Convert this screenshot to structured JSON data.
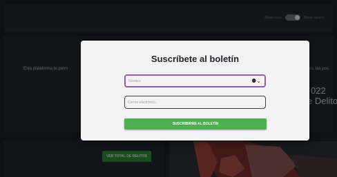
{
  "header": {
    "theme_light_label": "Modo claro",
    "theme_dark_label": "Modo oscuro"
  },
  "hero": {
    "intro_text_left": "Esta plataforma te perm",
    "intro_text_right": "nes, las pos",
    "year_partial": "022",
    "subtitle_partial": "e Delito"
  },
  "actions": {
    "total_button_label": "VER TOTAL DE DELITOS"
  },
  "modal": {
    "title": "Suscríbete al boletín",
    "name_placeholder": "Nombre",
    "email_placeholder": "Correo electrónico",
    "submit_label": "SUSCRIBIRME AL BOLETÍN",
    "name_icon": "password-manager-key-icon"
  },
  "colors": {
    "accent_green": "#4caf50",
    "focus_purple": "#8e5fa3",
    "background": "#1d2226"
  }
}
